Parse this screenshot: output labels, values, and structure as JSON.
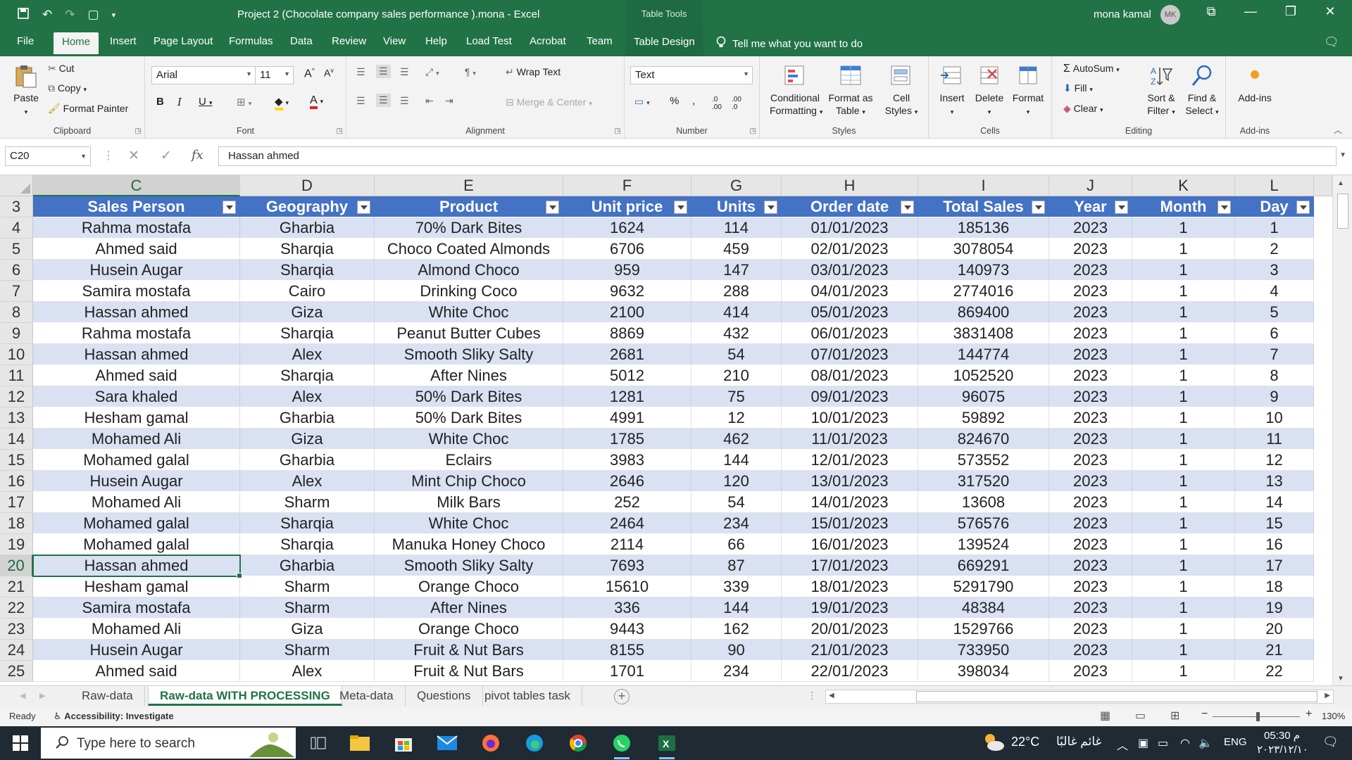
{
  "window": {
    "title": "Project 2 (Chocolate company sales performance ).mona  -  Excel",
    "context_label": "Table Tools",
    "user_name": "mona kamal",
    "user_initials": "MK"
  },
  "tabs": [
    "File",
    "Home",
    "Insert",
    "Page Layout",
    "Formulas",
    "Data",
    "Review",
    "View",
    "Help",
    "Load Test",
    "Acrobat",
    "Team",
    "Table Design"
  ],
  "active_tab": "Home",
  "tell_me": "Tell me what you want to do",
  "ribbon": {
    "clipboard": {
      "paste": "Paste",
      "cut": "Cut",
      "copy": "Copy",
      "format_painter": "Format Painter",
      "label": "Clipboard"
    },
    "font": {
      "name": "Arial",
      "size": "11",
      "label": "Font"
    },
    "alignment": {
      "wrap": "Wrap Text",
      "merge": "Merge & Center",
      "label": "Alignment"
    },
    "number": {
      "format": "Text",
      "label": "Number"
    },
    "styles": {
      "conditional": [
        "Conditional",
        "Formatting"
      ],
      "format_table": [
        "Format as",
        "Table"
      ],
      "cell_styles": [
        "Cell",
        "Styles"
      ],
      "label": "Styles"
    },
    "cells": {
      "insert": "Insert",
      "delete": "Delete",
      "format": "Format",
      "label": "Cells"
    },
    "editing": {
      "autosum": "AutoSum",
      "fill": "Fill",
      "clear": "Clear",
      "sort": [
        "Sort &",
        "Filter"
      ],
      "find": [
        "Find &",
        "Select"
      ],
      "label": "Editing"
    },
    "addins": {
      "button": "Add-ins",
      "label": "Add-ins"
    }
  },
  "formula_bar": {
    "name_box": "C20",
    "content": "Hassan ahmed"
  },
  "columns": [
    "C",
    "D",
    "E",
    "F",
    "G",
    "H",
    "I",
    "J",
    "K",
    "L"
  ],
  "selected_column": "C",
  "headers": [
    "Sales Person",
    "Geography",
    "Product",
    "Unit price",
    "Units",
    "Order date",
    "Total Sales",
    "Year",
    "Month",
    "Day"
  ],
  "header_row_number": "3",
  "rows": [
    {
      "n": "4",
      "c": [
        "Rahma mostafa",
        "Gharbia",
        "70% Dark Bites",
        "1624",
        "114",
        "01/01/2023",
        "185136",
        "2023",
        "1",
        "1"
      ]
    },
    {
      "n": "5",
      "c": [
        "Ahmed said",
        "Sharqia",
        "Choco Coated Almonds",
        "6706",
        "459",
        "02/01/2023",
        "3078054",
        "2023",
        "1",
        "2"
      ]
    },
    {
      "n": "6",
      "c": [
        "Husein Augar",
        "Sharqia",
        "Almond Choco",
        "959",
        "147",
        "03/01/2023",
        "140973",
        "2023",
        "1",
        "3"
      ]
    },
    {
      "n": "7",
      "c": [
        "Samira mostafa",
        "Cairo",
        "Drinking Coco",
        "9632",
        "288",
        "04/01/2023",
        "2774016",
        "2023",
        "1",
        "4"
      ]
    },
    {
      "n": "8",
      "c": [
        "Hassan ahmed",
        "Giza",
        "White Choc",
        "2100",
        "414",
        "05/01/2023",
        "869400",
        "2023",
        "1",
        "5"
      ]
    },
    {
      "n": "9",
      "c": [
        "Rahma mostafa",
        "Sharqia",
        "Peanut Butter Cubes",
        "8869",
        "432",
        "06/01/2023",
        "3831408",
        "2023",
        "1",
        "6"
      ]
    },
    {
      "n": "10",
      "c": [
        "Hassan ahmed",
        "Alex",
        "Smooth Sliky Salty",
        "2681",
        "54",
        "07/01/2023",
        "144774",
        "2023",
        "1",
        "7"
      ]
    },
    {
      "n": "11",
      "c": [
        "Ahmed said",
        "Sharqia",
        "After Nines",
        "5012",
        "210",
        "08/01/2023",
        "1052520",
        "2023",
        "1",
        "8"
      ]
    },
    {
      "n": "12",
      "c": [
        "Sara khaled",
        "Alex",
        "50% Dark Bites",
        "1281",
        "75",
        "09/01/2023",
        "96075",
        "2023",
        "1",
        "9"
      ]
    },
    {
      "n": "13",
      "c": [
        "Hesham gamal",
        "Gharbia",
        "50% Dark Bites",
        "4991",
        "12",
        "10/01/2023",
        "59892",
        "2023",
        "1",
        "10"
      ]
    },
    {
      "n": "14",
      "c": [
        "Mohamed Ali",
        "Giza",
        "White Choc",
        "1785",
        "462",
        "11/01/2023",
        "824670",
        "2023",
        "1",
        "11"
      ]
    },
    {
      "n": "15",
      "c": [
        "Mohamed galal",
        "Gharbia",
        "Eclairs",
        "3983",
        "144",
        "12/01/2023",
        "573552",
        "2023",
        "1",
        "12"
      ]
    },
    {
      "n": "16",
      "c": [
        "Husein Augar",
        "Alex",
        "Mint Chip Choco",
        "2646",
        "120",
        "13/01/2023",
        "317520",
        "2023",
        "1",
        "13"
      ]
    },
    {
      "n": "17",
      "c": [
        "Mohamed Ali",
        "Sharm",
        "Milk Bars",
        "252",
        "54",
        "14/01/2023",
        "13608",
        "2023",
        "1",
        "14"
      ]
    },
    {
      "n": "18",
      "c": [
        "Mohamed galal",
        "Sharqia",
        "White Choc",
        "2464",
        "234",
        "15/01/2023",
        "576576",
        "2023",
        "1",
        "15"
      ]
    },
    {
      "n": "19",
      "c": [
        "Mohamed galal",
        "Sharqia",
        "Manuka Honey Choco",
        "2114",
        "66",
        "16/01/2023",
        "139524",
        "2023",
        "1",
        "16"
      ]
    },
    {
      "n": "20",
      "c": [
        "Hassan ahmed",
        "Gharbia",
        "Smooth Sliky Salty",
        "7693",
        "87",
        "17/01/2023",
        "669291",
        "2023",
        "1",
        "17"
      ]
    },
    {
      "n": "21",
      "c": [
        "Hesham gamal",
        "Sharm",
        "Orange Choco",
        "15610",
        "339",
        "18/01/2023",
        "5291790",
        "2023",
        "1",
        "18"
      ]
    },
    {
      "n": "22",
      "c": [
        "Samira mostafa",
        "Sharm",
        "After Nines",
        "336",
        "144",
        "19/01/2023",
        "48384",
        "2023",
        "1",
        "19"
      ]
    },
    {
      "n": "23",
      "c": [
        "Mohamed Ali",
        "Giza",
        "Orange Choco",
        "9443",
        "162",
        "20/01/2023",
        "1529766",
        "2023",
        "1",
        "20"
      ]
    },
    {
      "n": "24",
      "c": [
        "Husein Augar",
        "Sharm",
        "Fruit & Nut Bars",
        "8155",
        "90",
        "21/01/2023",
        "733950",
        "2023",
        "1",
        "21"
      ]
    },
    {
      "n": "25",
      "c": [
        "Ahmed said",
        "Alex",
        "Fruit & Nut Bars",
        "1701",
        "234",
        "22/01/2023",
        "398034",
        "2023",
        "1",
        "22"
      ]
    }
  ],
  "active_row": "20",
  "sheets": [
    "Raw-data",
    "Raw-data WITH PROCESSING",
    "Meta-data",
    "Questions",
    "pivot tables task"
  ],
  "active_sheet": "Raw-data WITH PROCESSING",
  "status": {
    "ready": "Ready",
    "accessibility": "Accessibility: Investigate",
    "zoom": "130%"
  },
  "taskbar": {
    "search_placeholder": "Type here to search",
    "temperature": "22°C",
    "weather": "غائم غالبًا",
    "lang": "ENG",
    "time": "05:30 م",
    "date": "٢٠٢٣/١٢/١٠"
  },
  "colors": {
    "excel_green": "#217346",
    "table_header": "#4472c4",
    "band": "#d9e1f2"
  }
}
